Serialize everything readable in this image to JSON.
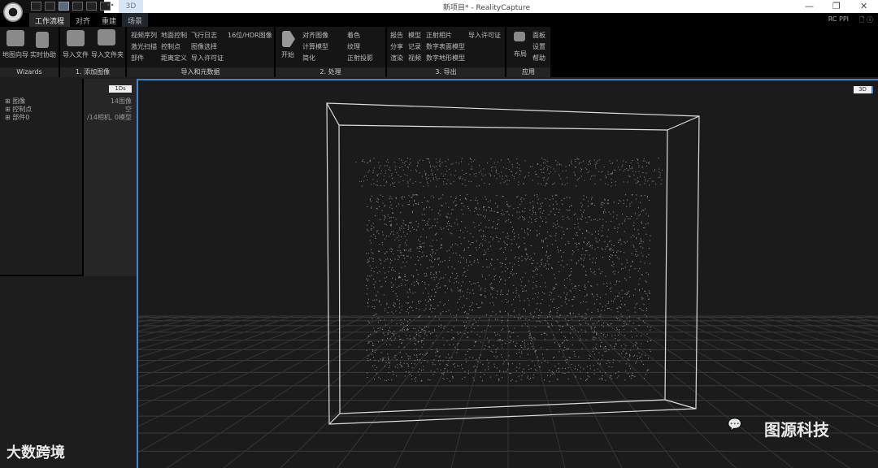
{
  "window": {
    "title": "新项目* - RealityCapture",
    "view_tab": "3D",
    "more": "••"
  },
  "menu": {
    "tabs": [
      "工作流程",
      "对齐",
      "重建",
      "场景"
    ],
    "right_label": "RC PPI"
  },
  "ribbon": {
    "wizards": {
      "label": "Wizards",
      "items": [
        "地图向导",
        "实时协助"
      ]
    },
    "add_images": {
      "label": "1. 添加图像",
      "items": [
        "导入文件",
        "导入文件夹"
      ]
    },
    "import_meta": {
      "label": "导入和元数据",
      "items": [
        "视频序列",
        "地面控制",
        "飞行日志",
        "16位/HDR图像",
        "激光扫描",
        "控制点",
        "图像选择",
        "部件",
        "距离定义",
        "导入许可证"
      ]
    },
    "process": {
      "label": "2. 处理",
      "start": "开始",
      "items": [
        "对齐图像",
        "着色",
        "计算模型",
        "纹理",
        "简化",
        "正射投影"
      ]
    },
    "export": {
      "label": "3. 导出",
      "items": [
        "报告",
        "模型",
        "正射相片",
        "导入许可证",
        "分享",
        "记录",
        "数字表面模型",
        "渲染",
        "视频",
        "数字地形模型"
      ]
    },
    "app": {
      "label": "应用",
      "layout": "布局",
      "items": [
        "面板",
        "设置",
        "帮助"
      ]
    }
  },
  "left_panel": {
    "button": "1Ds",
    "tree": [
      "图像",
      "控制点",
      "部件0"
    ],
    "values": [
      "14图像",
      "空",
      "/14相机, 0模型"
    ]
  },
  "viewport": {
    "button": "3D"
  },
  "watermarks": {
    "left": "大数跨境",
    "right": "图源科技"
  }
}
